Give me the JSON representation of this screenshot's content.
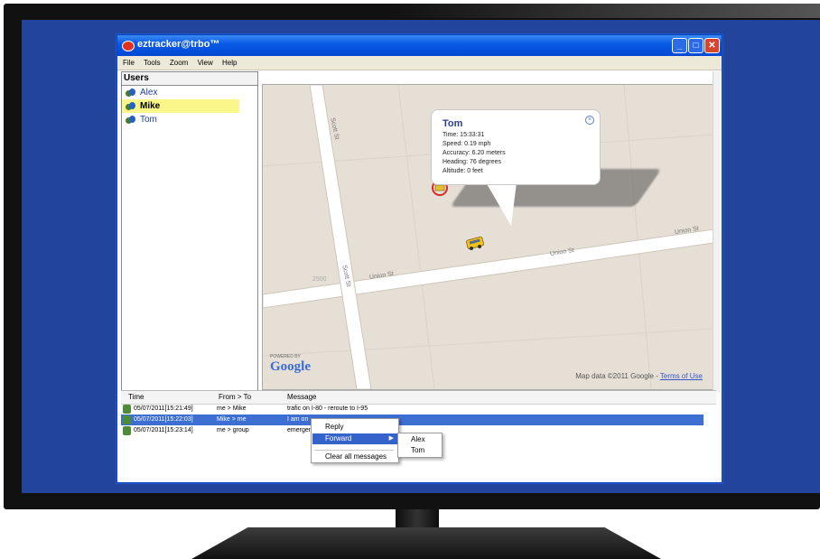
{
  "app": {
    "title": "eztracker@trbo™"
  },
  "window_controls": {
    "minimize": "_",
    "maximize": "□",
    "close": "✕"
  },
  "menu": [
    "File",
    "Tools",
    "Zoom",
    "View",
    "Help"
  ],
  "users": {
    "header": "Users",
    "items": [
      {
        "name": "Alex",
        "selected": false
      },
      {
        "name": "Mike",
        "selected": true
      },
      {
        "name": "Tom",
        "selected": false
      }
    ]
  },
  "map": {
    "streets": {
      "scott_upper": "Scott St",
      "scott_lower": "Scott St",
      "union_left": "Union St",
      "union_mid": "Union St",
      "union_right": "Union St",
      "number": "2500"
    },
    "popup": {
      "name": "Tom",
      "lines": [
        "Time: 15:33:31",
        "Speed: 0.19 mph",
        "Accuracy: 6.20 meters",
        "Heading: 76 degrees",
        "Altitude: 0 feet"
      ]
    },
    "powered_by": "POWERED BY",
    "google": "Google",
    "map_data": "Map data ©2011 Google -",
    "terms": "Terms of Use"
  },
  "messages": {
    "columns": [
      "Time",
      "From > To",
      "Message"
    ],
    "rows": [
      {
        "time": "05/07/2011[15:21:49]",
        "from_to": "me > Mike",
        "message": "trafic on I-80 - reroute to I-95",
        "selected": false
      },
      {
        "time": "05/07/2011[15:22:03]",
        "from_to": "Mike > me",
        "message": "I am on",
        "selected": true
      },
      {
        "time": "05/07/2011[15:23:14]",
        "from_to": "me > group",
        "message": "emergen",
        "selected": false
      }
    ]
  },
  "context_menu": {
    "items": [
      "Reply",
      "Forward",
      "Clear all messages"
    ],
    "highlighted": "Forward",
    "submenu": [
      "Alex",
      "Tom"
    ]
  },
  "colors": {
    "desktop": "#22449a",
    "selection": "#3c6fd1",
    "user_highlight": "#fbf68a"
  }
}
